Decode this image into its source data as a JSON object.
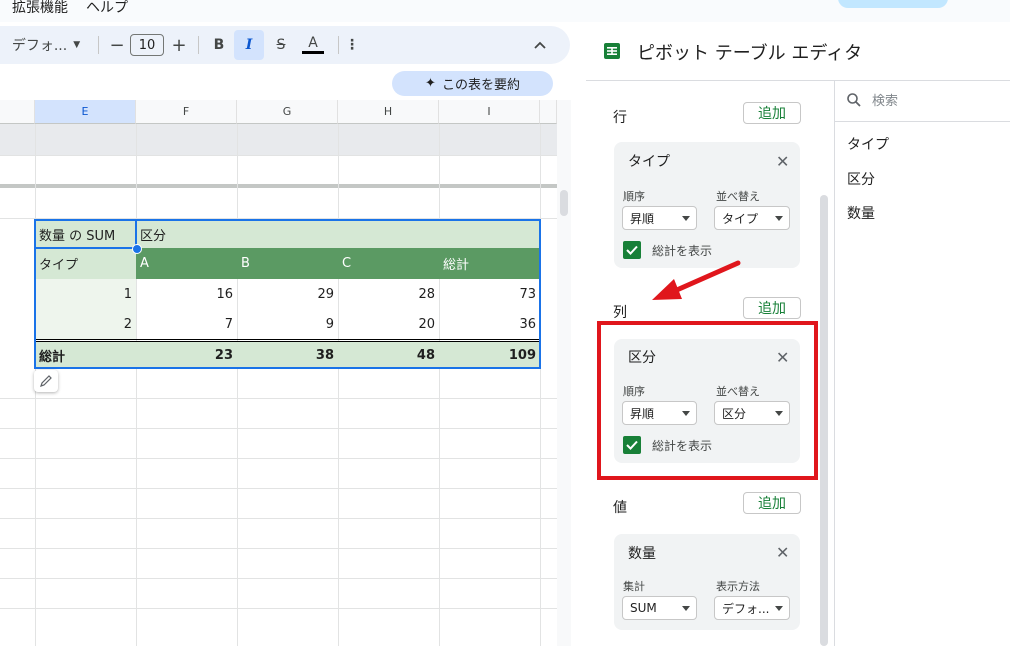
{
  "menu": {
    "extensions": "拡張機能",
    "help": "ヘルプ"
  },
  "toolbar": {
    "font": "デフォ...",
    "font_size": "10",
    "bold": "B",
    "italic": "I",
    "strike": "S",
    "text_color": "A",
    "more": "⋮",
    "collapse": "^"
  },
  "summary_chip": {
    "icon": "✦",
    "label": "この表を要約"
  },
  "columns": [
    "E",
    "F",
    "G",
    "H",
    "I"
  ],
  "pivot": {
    "title": "数量 の SUM",
    "col_field": "区分",
    "row_field": "タイプ",
    "col_labels": [
      "A",
      "B",
      "C",
      "総計"
    ],
    "rows": [
      {
        "key": "1",
        "values": [
          "16",
          "29",
          "28",
          "73"
        ]
      },
      {
        "key": "2",
        "values": [
          "7",
          "9",
          "20",
          "36"
        ]
      }
    ],
    "total": {
      "label": "総計",
      "values": [
        "23",
        "38",
        "48",
        "109"
      ]
    }
  },
  "panel": {
    "title": "ピボット テーブル エディタ",
    "rows_label": "行",
    "cols_label": "列",
    "values_label": "値",
    "add": "追加",
    "row_card": {
      "field": "タイプ",
      "order_label": "順序",
      "order": "昇順",
      "sort_label": "並べ替え",
      "sort": "タイプ",
      "show_total": "総計を表示"
    },
    "col_card": {
      "field": "区分",
      "order_label": "順序",
      "order": "昇順",
      "sort_label": "並べ替え",
      "sort": "区分",
      "show_total": "総計を表示"
    },
    "val_card": {
      "field": "数量",
      "agg_label": "集計",
      "agg": "SUM",
      "display_label": "表示方法",
      "display": "デフォ..."
    },
    "search_placeholder": "検索",
    "fields": [
      "タイプ",
      "区分",
      "数量"
    ]
  },
  "colors": {
    "pivot_header_green": "#5b9a63",
    "pivot_light_green": "#d5e8d4",
    "selection_blue": "#1a73e8",
    "highlight_red": "#e0161c",
    "accent_green": "#188038"
  }
}
